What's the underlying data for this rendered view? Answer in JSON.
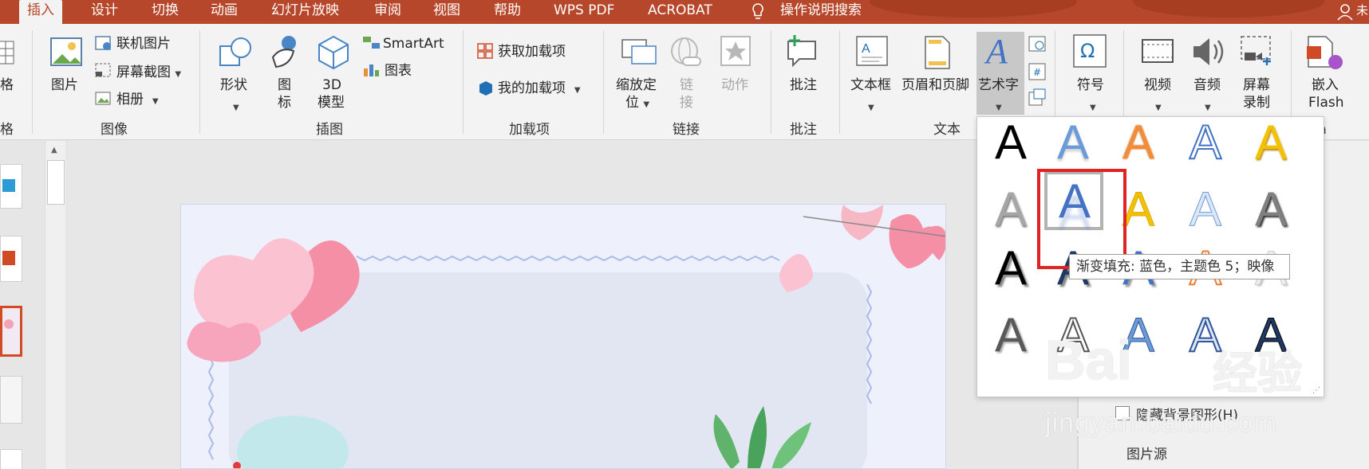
{
  "tabs": [
    {
      "label": "插入",
      "active": true
    },
    {
      "label": "设计"
    },
    {
      "label": "切换"
    },
    {
      "label": "动画"
    },
    {
      "label": "幻灯片放映"
    },
    {
      "label": "审阅"
    },
    {
      "label": "视图"
    },
    {
      "label": "帮助"
    },
    {
      "label": "WPS PDF"
    },
    {
      "label": "ACROBAT"
    },
    {
      "label": "操作说明搜索"
    }
  ],
  "user_initial": "未",
  "ribbon": {
    "table_partial": "格",
    "table_group_partial": "格",
    "image_group": {
      "picture": "图片",
      "online_picture": "联机图片",
      "screenshot": "屏幕截图",
      "album": "相册",
      "label": "图像"
    },
    "illustration_group": {
      "shapes": "形状",
      "icons_line1": "图",
      "icons_line2": "标",
      "model_line1": "3D",
      "model_line2": "模型",
      "smartart": "SmartArt",
      "chart": "图表",
      "label": "插图"
    },
    "addins_group": {
      "get_addins": "获取加载项",
      "my_addins": "我的加载项",
      "label": "加载项"
    },
    "links_group": {
      "zoom_line1": "缩放定",
      "zoom_line2": "位",
      "link_line1": "链",
      "link_line2": "接",
      "action": "动作",
      "label": "链接"
    },
    "comments_group": {
      "comment": "批注",
      "label": "批注"
    },
    "text_group": {
      "textbox": "文本框",
      "header_footer": "页眉和页脚",
      "wordart": "艺术字",
      "label": "文本"
    },
    "symbols_group": {
      "symbol": "符号"
    },
    "media_group": {
      "video": "视频",
      "audio": "音频",
      "screen_rec_line1": "屏幕",
      "screen_rec_line2": "录制",
      "label_partial": "h"
    },
    "flash_group": {
      "line1": "嵌入",
      "line2": "Flash"
    }
  },
  "wordart_gallery": {
    "letter": "A",
    "tooltip": "渐变填充: 蓝色，主题色 5；映像",
    "selected_index": 6
  },
  "right_pane": {
    "hide_bg": "隐藏背景图形(H)",
    "picture_source": "图片源"
  },
  "watermark": {
    "brand": "Bai",
    "brand2": "经验",
    "url": "jingyan.baidu.com"
  },
  "colors": {
    "accent": "#b7472a",
    "highlight": "#e02424",
    "wordart_blue": "#4472c4"
  }
}
